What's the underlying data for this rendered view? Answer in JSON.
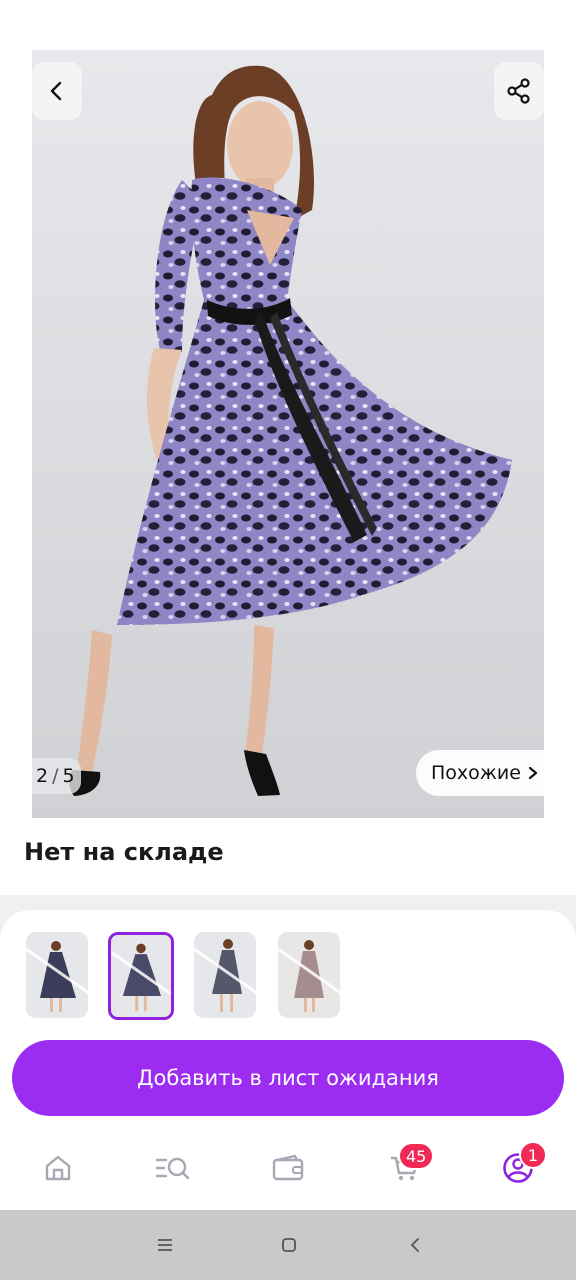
{
  "product": {
    "image_counter_current": "2",
    "image_counter_separator": "/",
    "image_counter_total": "5",
    "similar_label": "Похожие",
    "stock_status": "Нет на складе"
  },
  "thumbnails": [
    {
      "color": "#3c3d5a",
      "selected": false
    },
    {
      "color": "#4a4a68",
      "selected": true
    },
    {
      "color": "#55586a",
      "selected": false
    },
    {
      "color": "#a58d8f",
      "selected": false
    }
  ],
  "actions": {
    "waitlist_label": "Добавить в лист ожидания"
  },
  "nav": {
    "items": [
      {
        "icon": "home-icon"
      },
      {
        "icon": "catalog-search-icon"
      },
      {
        "icon": "wallet-icon"
      },
      {
        "icon": "cart-icon",
        "badge": "45"
      },
      {
        "icon": "profile-icon",
        "badge": "1"
      }
    ]
  },
  "system_nav": {
    "icons": [
      "menu-icon",
      "home-square-icon",
      "back-chevron-icon"
    ]
  },
  "colors": {
    "accent": "#9d2cf2",
    "badge": "#f02a55",
    "icon_inactive": "#a8a8b4",
    "icon_active": "#8e22e0"
  }
}
